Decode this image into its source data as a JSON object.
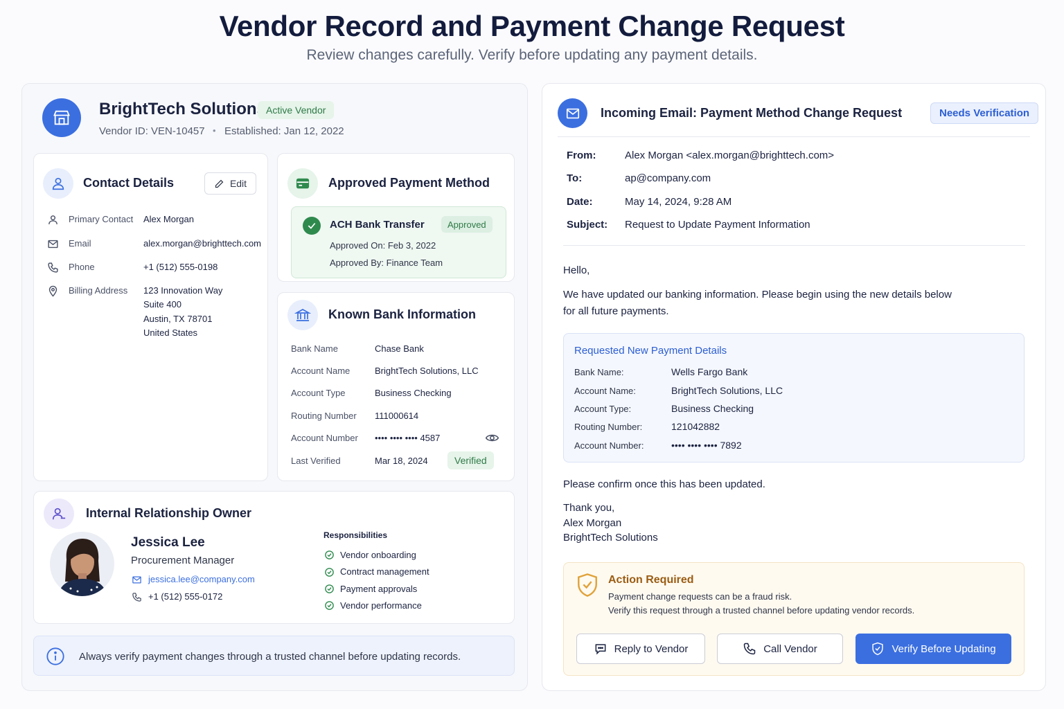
{
  "page": {
    "title": "Vendor Record and Payment Change Request",
    "subtitle": "Review changes carefully. Verify before updating any payment details."
  },
  "vendor": {
    "name": "BrightTech Solutions",
    "status_badge": "Active Vendor",
    "vendor_id": "Vendor ID: VEN-10457",
    "separator": "•",
    "established": "Established: Jan 12, 2022"
  },
  "contact": {
    "title": "Contact Details",
    "edit_label": "Edit",
    "rows": [
      {
        "label": "Primary Contact",
        "value": "Alex Morgan",
        "icon": "person-icon"
      },
      {
        "label": "Email",
        "value": "alex.morgan@brighttech.com",
        "icon": "mail-icon"
      },
      {
        "label": "Phone",
        "value": "+1 (512) 555-0198",
        "icon": "phone-icon"
      },
      {
        "label": "Billing Address",
        "value": "123 Innovation Way",
        "icon": "location-pin-icon"
      }
    ],
    "address_lines": [
      "Suite 400",
      "Austin, TX 78701",
      "United States"
    ]
  },
  "approved_method": {
    "title": "Approved Payment Method",
    "method": "ACH Bank Transfer",
    "badge": "Approved",
    "approved_on": "Approved On: Feb 3, 2022",
    "approved_by": "Approved By: Finance Team"
  },
  "bank": {
    "title": "Known Bank Information",
    "rows": [
      {
        "label": "Bank Name",
        "value": "Chase Bank"
      },
      {
        "label": "Account Name",
        "value": "BrightTech Solutions, LLC"
      },
      {
        "label": "Account Type",
        "value": "Business Checking"
      },
      {
        "label": "Routing Number",
        "value": "111000614"
      },
      {
        "label": "Account Number",
        "value": "•••• •••• •••• 4587"
      },
      {
        "label": "Last Verified",
        "value": "Mar 18, 2024"
      }
    ],
    "verified_badge": "Verified"
  },
  "owner": {
    "title": "Internal Relationship Owner",
    "name": "Jessica Lee",
    "role": "Procurement Manager",
    "email": "jessica.lee@company.com",
    "phone": "+1 (512) 555-0172",
    "responsibilities_title": "Responsibilities",
    "responsibilities": [
      "Vendor onboarding",
      "Contract management",
      "Payment approvals",
      "Vendor performance"
    ]
  },
  "info_bar": {
    "text": "Always verify payment changes through a trusted channel before updating records."
  },
  "email": {
    "title": "Incoming Email: Payment Method Change Request",
    "badge": "Needs Verification",
    "headers": [
      {
        "label": "From:",
        "value": "Alex Morgan <alex.morgan@brighttech.com>"
      },
      {
        "label": "To:",
        "value": "ap@company.com"
      },
      {
        "label": "Date:",
        "value": "May 14, 2024, 9:28 AM"
      },
      {
        "label": "Subject:",
        "value": "Request to Update Payment Information"
      }
    ],
    "greeting": "Hello,",
    "body_line1": "We have updated our banking information. Please begin using the new details below",
    "body_line2": "for all future payments.",
    "requested": {
      "title": "Requested New Payment Details",
      "rows": [
        {
          "label": "Bank Name:",
          "value": "Wells Fargo Bank"
        },
        {
          "label": "Account Name:",
          "value": "BrightTech Solutions, LLC"
        },
        {
          "label": "Account Type:",
          "value": "Business Checking"
        },
        {
          "label": "Routing Number:",
          "value": "121042882"
        },
        {
          "label": "Account Number:",
          "value": "•••• •••• •••• 7892"
        }
      ]
    },
    "confirm": "Please confirm once this has been updated.",
    "signoff": [
      "Thank you,",
      "Alex Morgan",
      "BrightTech Solutions"
    ]
  },
  "action": {
    "title": "Action Required",
    "line1": "Payment change requests can be a fraud risk.",
    "line2": "Verify this request through a trusted channel before updating vendor records.",
    "reply_label": "Reply to Vendor",
    "call_label": "Call Vendor",
    "verify_label": "Verify Before Updating"
  },
  "colors": {
    "accent": "#3b6fe0",
    "success": "#2f8a4e",
    "warning": "#b9761a",
    "text": "#1b2240"
  }
}
